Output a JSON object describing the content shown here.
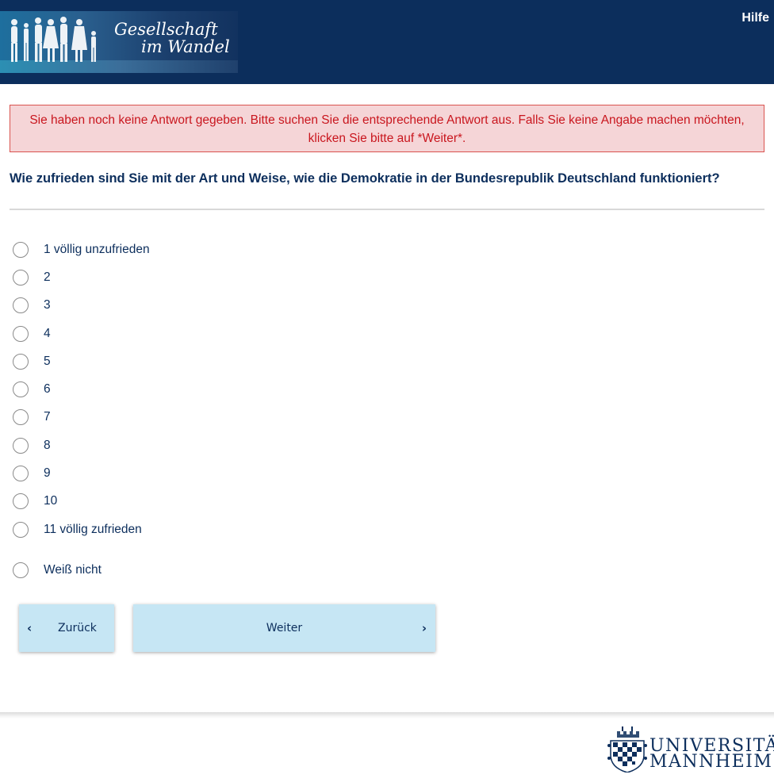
{
  "header": {
    "logo_line1": "Gesellschaft",
    "logo_line2": "im Wandel",
    "help_label": "Hilfe",
    "background_color": "#0c2e5c"
  },
  "alert": {
    "message": "Sie haben noch keine Antwort gegeben. Bitte suchen Sie die entsprechende Antwort aus. Falls Sie keine Angabe machen möchten, klicken Sie bitte auf *Weiter*.",
    "text_color": "#c9161e",
    "background_color": "#f5d5d7"
  },
  "question": {
    "text": "Wie zufrieden sind Sie mit der Art und Weise, wie die Demokratie in der Bundesrepublik Deutschland funktioniert?"
  },
  "options": [
    {
      "label": "1 völlig unzufrieden",
      "selected": false
    },
    {
      "label": "2",
      "selected": false
    },
    {
      "label": "3",
      "selected": false
    },
    {
      "label": "4",
      "selected": false
    },
    {
      "label": "5",
      "selected": false
    },
    {
      "label": "6",
      "selected": false
    },
    {
      "label": "7",
      "selected": false
    },
    {
      "label": "8",
      "selected": false
    },
    {
      "label": "9",
      "selected": false
    },
    {
      "label": "10",
      "selected": false
    },
    {
      "label": "11 völlig zufrieden",
      "selected": false
    },
    {
      "label": "Weiß nicht",
      "selected": false
    }
  ],
  "navigation": {
    "back_label": "Zurück",
    "next_label": "Weiter",
    "back_icon": "chevron-left-icon",
    "next_icon": "chevron-right-icon"
  },
  "footer": {
    "university_line1": "UNIVERSITÄT",
    "university_line2": "MANNHEIM"
  }
}
